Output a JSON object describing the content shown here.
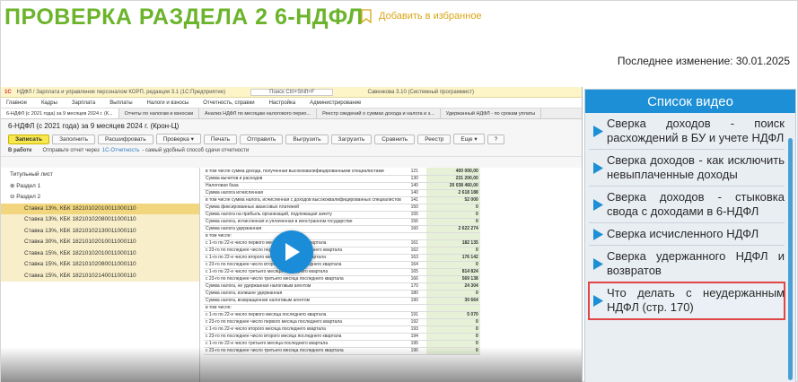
{
  "header": {
    "title": "ПРОВЕРКА РАЗДЕЛА 2 6-НДФЛ",
    "favorite_label": "Добавить в избранное",
    "last_updated": "Последнее изменение: 30.01.2025"
  },
  "video": {
    "app_title": "НДФЛ / Зарплата и управление персоналом КОРП, редакция 3.1 (1С:Предприятие)",
    "search_placeholder": "Поиск Ctrl+Shift+F",
    "user": "Савенкова 3.10 (Системный программист)",
    "menu": [
      "Главное",
      "Кадры",
      "Зарплата",
      "Выплаты",
      "Налоги и взносы",
      "Отчетность, справки",
      "Настройка",
      "Администрирование"
    ],
    "tabs": [
      "6-НДФЛ (с 2021 года) за 9 месяцев 2024 г. (К...",
      "Отчеты по налогам и взносам",
      "Анализ НДФЛ по месяцам налогового перио...",
      "Реестр сведений о суммах дохода и налога и з...",
      "Удержанный НДФЛ - по срокам уплаты"
    ],
    "doc_title": "6-НДФЛ (с 2021 года) за 9 месяцев 2024 г. (Крон-Ц)",
    "toolbar": [
      "Записать",
      "Заполнить",
      "Расшифровать",
      "Проверка ▾",
      "Печать",
      "Отправить",
      "Выгрузить",
      "Загрузить",
      "Сравнить",
      "Реестр",
      "Еще ▾",
      "?"
    ],
    "status_state": "В работе",
    "status_text": "Отправьте отчет через",
    "status_link": "1С-Отчетность",
    "status_tail": "- самый удобный способ сдачи отчетности",
    "tree": [
      {
        "label": "Титульный лист",
        "level": "grp"
      },
      {
        "label": "⊕ Раздел 1",
        "level": "grp"
      },
      {
        "label": "⊖ Раздел 2",
        "level": "grp"
      },
      {
        "label": "Ставка 13%, КБК 18210102010011000110",
        "level": "l2",
        "selected": true
      },
      {
        "label": "Ставка 13%, КБК 18210102080011000110",
        "level": "l2"
      },
      {
        "label": "Ставка 13%, КБК 18210102130011000110",
        "level": "l2"
      },
      {
        "label": "Ставка 30%, КБК 18210102010011000110",
        "level": "l2"
      },
      {
        "label": "Ставка 15%, КБК 18210102010011000110",
        "level": "l2"
      },
      {
        "label": "Ставка 15%, КБК 18210102080011000110",
        "level": "l2"
      },
      {
        "label": "Ставка 15%, КБК 18210102140011000110",
        "level": "l2"
      }
    ],
    "rows": [
      [
        "в том числе сумма дохода, полученная высококвалифицированными специалистами",
        "121",
        "400 000,00"
      ],
      [
        "Сумма вычетов и расходов",
        "130",
        "231 200,00"
      ],
      [
        "Налоговая база",
        "140",
        "20 038 460,00"
      ],
      [
        "Сумма налога исчисленная",
        "140",
        "2 618 188"
      ],
      [
        "в том числе сумма налога, исчисленная с доходов высококвалифицированных специалистов",
        "141",
        "52 000"
      ],
      [
        "Сумма фиксированных авансовых платежей",
        "150",
        "0"
      ],
      [
        "Сумма налога на прибыль организаций, подлежащая зачету",
        "155",
        "0"
      ],
      [
        "Сумма налога, исчисленная и уплаченная в иностранном государстве",
        "156",
        "0"
      ],
      [
        "Сумма налога удержанная",
        "160",
        "2 622 274"
      ],
      [
        "в том числе:",
        "",
        ""
      ],
      [
        "с 1-го по 22-е число первого месяца последнего квартала",
        "161",
        "182 135"
      ],
      [
        "с 23-го по последнее число первого месяца последнего квартала",
        "162",
        "0"
      ],
      [
        "с 1-го по 22-е число второго месяца последнего квартала",
        "163",
        "176 142"
      ],
      [
        "с 23-го по последнее число второго месяца последнего квартала",
        "164",
        "0"
      ],
      [
        "с 1-го по 22-е число третьего месяца последнего квартала",
        "165",
        "814 824"
      ],
      [
        "с 23-го по последнее число третьего месяца последнего квартала",
        "166",
        "569 138"
      ],
      [
        "Сумма налога, не удержанная налоговым агентом",
        "170",
        "24 304"
      ],
      [
        "Сумма налога, излишне удержанная",
        "180",
        "0"
      ],
      [
        "Сумма налога, возвращенная налоговым агентом",
        "190",
        "30 664"
      ],
      [
        "в том числе:",
        "",
        ""
      ],
      [
        "с 1-го по 22-е число первого месяца последнего квартала",
        "191",
        "5 070"
      ],
      [
        "с 23-го по последнее число первого месяца последнего квартала",
        "192",
        "0"
      ],
      [
        "с 1-го по 22-е число второго месяца последнего квартала",
        "193",
        "0"
      ],
      [
        "с 23-го по последнее число второго месяца последнего квартала",
        "194",
        "0"
      ],
      [
        "с 1-го по 22-е число третьего месяца последнего квартала",
        "195",
        "0"
      ],
      [
        "с 23-го по последнее число третьего месяца последнего квартала",
        "196",
        "0"
      ]
    ]
  },
  "sidebar": {
    "heading": "Список видео",
    "items": [
      {
        "label": "Сверка доходов - поиск расхождений в БУ и учете НДФЛ",
        "highlighted": false
      },
      {
        "label": "Сверка доходов - как исключить невыплаченные доходы",
        "highlighted": false
      },
      {
        "label": "Сверка доходов - стыковка свода с доходами в 6-НДФЛ",
        "highlighted": false
      },
      {
        "label": "Сверка исчисленного НДФЛ",
        "highlighted": false
      },
      {
        "label": "Сверка удержанного НДФЛ и возвратов",
        "highlighted": false
      },
      {
        "label": "Что делать с неудержанным НДФЛ (стр. 170)",
        "highlighted": true
      }
    ]
  },
  "colors": {
    "title": "#6bb42b",
    "favorite": "#d9a514",
    "accent": "#1d8fd6",
    "highlight_border": "#e14646"
  }
}
